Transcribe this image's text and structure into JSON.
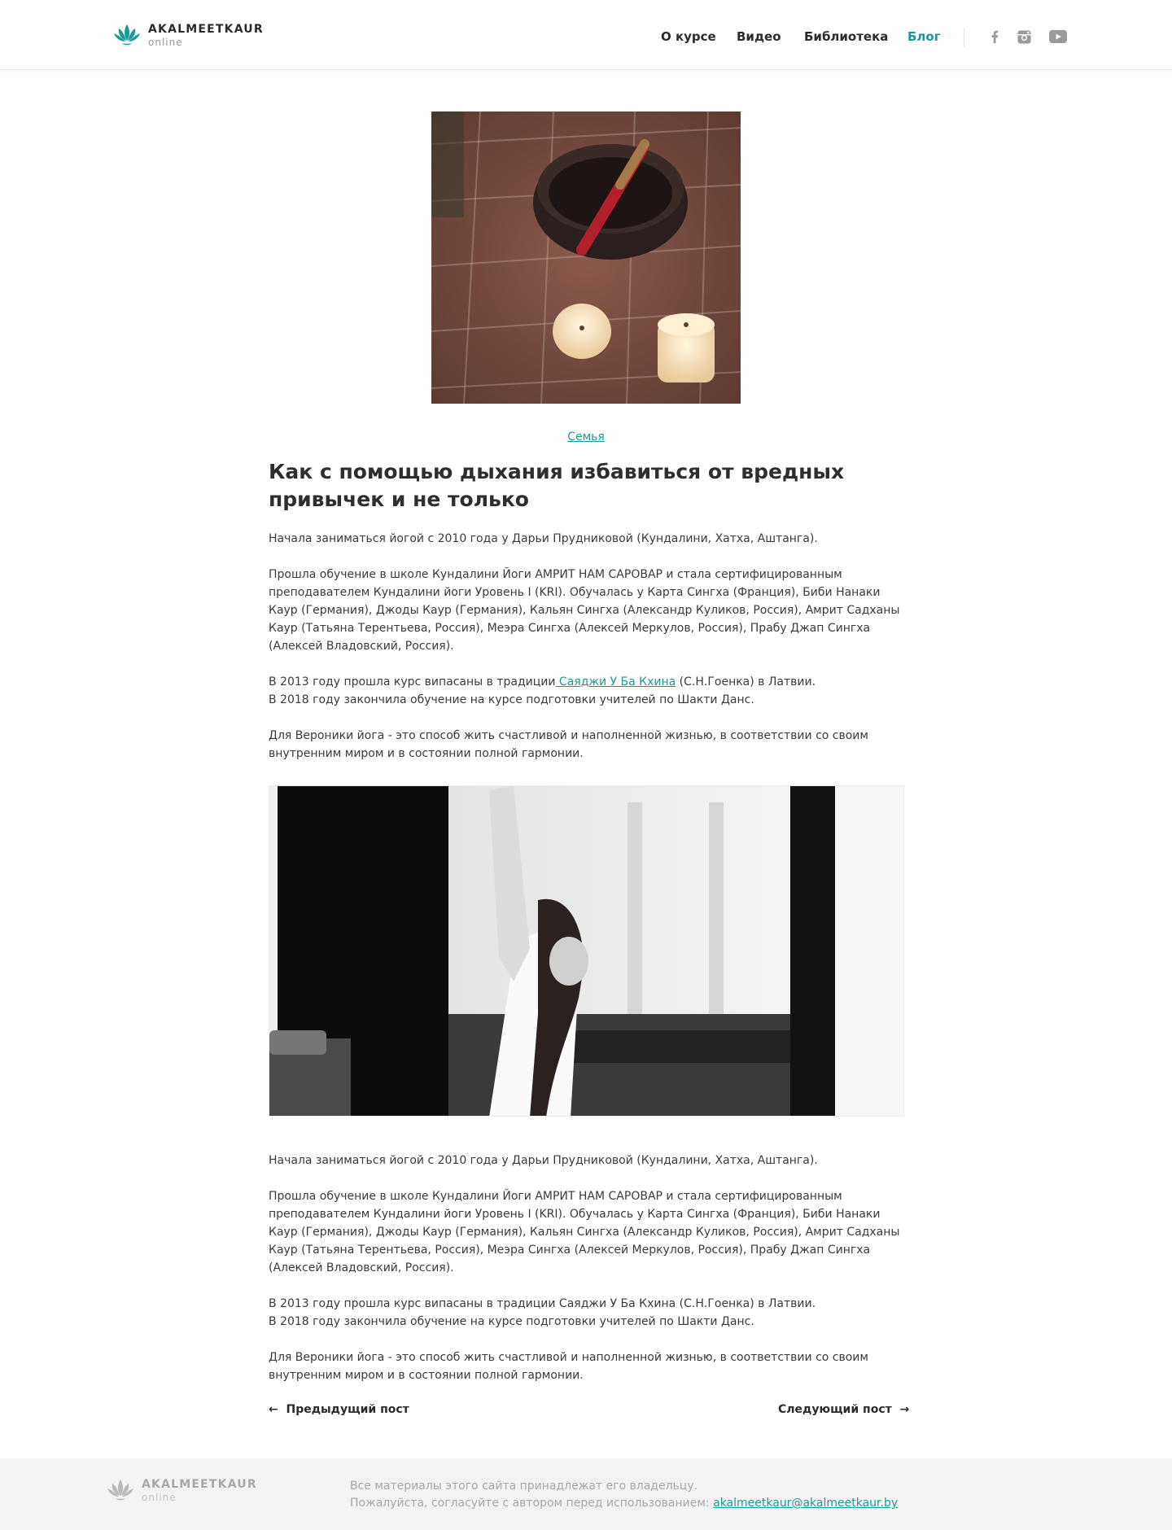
{
  "header": {
    "brand_name": "AKALMEETKAUR",
    "brand_sub": "online",
    "nav": [
      {
        "label": "О курсе"
      },
      {
        "label": "Видео"
      },
      {
        "label": "Библиотека"
      },
      {
        "label": "Блог"
      }
    ],
    "social": [
      "facebook-icon",
      "instagram-icon",
      "youtube-icon"
    ]
  },
  "colors": {
    "accent": "#1a9a96",
    "text": "#3a3a3a",
    "footer_bg": "#f3f3f3"
  },
  "article": {
    "category": "Семья",
    "title": "Как с помощью дыхания избавиться от вредных привычек и не только",
    "p1": "Начала заниматься йогой с 2010 года у Дарьи  Прудниковой (Кундалини, Хатха, Аштанга).",
    "p2": "Прошла обучение в школе  Кундалини  Йоги АМРИТ  НАМ САРОВАР и стала сертифицированным преподавателем  Кундалини йоги Уровень I (KRI). Обучалась у  Карта Сингха (Франция),  Биби  Нанаки  Каур (Германия), Джоды  Каур (Германия),  Кальян Сингха (Александр  Куликов,  Россия), Амрит Садханы  Каур (Татьяна Терентьева,  Россия),  Меэра Сингха (Алексей  Меркулов,  Россия),  Прабу Джап Сингха (Алексей Владовский,  Россия).",
    "p3_before": "В 2013 году прошла курс випасаны в традиции",
    "p3_link": " Саяджи У  Ба  Кхина",
    "p3_after": " (С.Н.Гоенка) в Латвии.",
    "p3_line2": "В 2018 году закончила обучение на курсе подготовки учителей по  Шакти Данс.",
    "p4": "Для  Вероники йога - это способ жить счастливой и наполненной жизнью, в соответствии со своим внутренним миром и в состоянии полной гармонии.",
    "q1": "Начала заниматься йогой с 2010 года у Дарьи  Прудниковой (Кундалини, Хатха, Аштанга).",
    "q2": "Прошла обучение в школе  Кундалини  Йоги АМРИТ  НАМ САРОВАР и стала сертифицированным преподавателем  Кундалини йоги Уровень I (KRI). Обучалась у  Карта Сингха (Франция),  Биби  Нанаки  Каур (Германия), Джоды  Каур (Германия),  Кальян Сингха (Александр  Куликов,  Россия), Амрит Садханы  Каур (Татьяна Терентьева,  Россия),  Меэра Сингха (Алексей  Меркулов,  Россия),  Прабу Джап Сингха (Алексей Владовский,  Россия).",
    "q3_line1": "В 2013 году прошла курс випасаны в традиции Саяджи У  Ба  Кхина (С.Н.Гоенка) в Латвии.",
    "q3_line2": "В 2018 году закончила обучение на курсе подготовки учителей по  Шакти Данс.",
    "q4": "Для  Вероники йога - это способ жить счастливой и наполненной жизнью, в соответствии со своим внутренним миром и в состоянии полной гармонии."
  },
  "post_nav": {
    "prev_arrow": "←",
    "prev": "Предыдущий пост",
    "next": "Следующий пост",
    "next_arrow": "→"
  },
  "footer": {
    "brand_name": "AKALMEETKAUR",
    "brand_sub": "online",
    "line1": "Все материалы этого сайта принадлежат его владельцу.",
    "line2": "Пожалуйста, согласуйте с автором перед использованием: ",
    "email": "akalmeetkaur@akalmeetkaur.by"
  }
}
